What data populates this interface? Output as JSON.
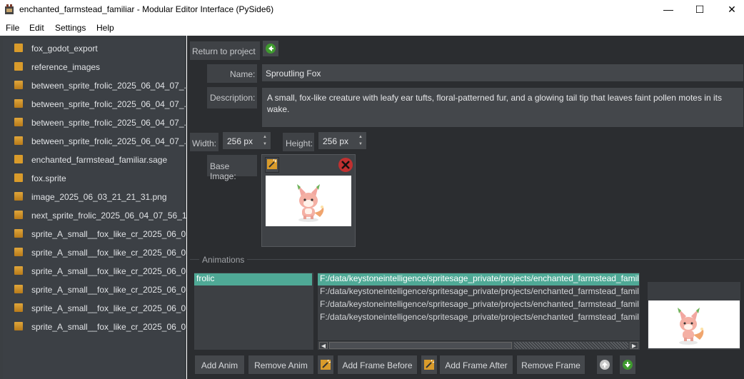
{
  "window": {
    "title": "enchanted_farmstead_familiar - Modular Editor Interface (PySide6)",
    "minimize": "—",
    "maximize": "☐",
    "close": "✕"
  },
  "menu": [
    "File",
    "Edit",
    "Settings",
    "Help"
  ],
  "files": [
    {
      "label": "fox_godot_export",
      "icon": "folder-icon"
    },
    {
      "label": "reference_images",
      "icon": "folder-icon"
    },
    {
      "label": "between_sprite_frolic_2025_06_04_07_...",
      "icon": "image-icon"
    },
    {
      "label": "between_sprite_frolic_2025_06_04_07_...",
      "icon": "image-icon"
    },
    {
      "label": "between_sprite_frolic_2025_06_04_07_...",
      "icon": "image-icon"
    },
    {
      "label": "between_sprite_frolic_2025_06_04_07_...",
      "icon": "image-icon"
    },
    {
      "label": "enchanted_farmstead_familiar.sage",
      "icon": "project-file-icon"
    },
    {
      "label": "fox.sprite",
      "icon": "sprite-file-icon"
    },
    {
      "label": "image_2025_06_03_21_21_31.png",
      "icon": "image-icon"
    },
    {
      "label": "next_sprite_frolic_2025_06_04_07_56_1...",
      "icon": "image-icon"
    },
    {
      "label": "sprite_A_small__fox_like_cr_2025_06_0...",
      "icon": "image-icon"
    },
    {
      "label": "sprite_A_small__fox_like_cr_2025_06_0...",
      "icon": "image-icon"
    },
    {
      "label": "sprite_A_small__fox_like_cr_2025_06_0...",
      "icon": "image-icon"
    },
    {
      "label": "sprite_A_small__fox_like_cr_2025_06_0...",
      "icon": "image-icon"
    },
    {
      "label": "sprite_A_small__fox_like_cr_2025_06_0...",
      "icon": "image-icon"
    },
    {
      "label": "sprite_A_small__fox_like_cr_2025_06_0...",
      "icon": "image-icon"
    }
  ],
  "editor": {
    "return_label": "Return to project",
    "name_label": "Name:",
    "name_value": "Sproutling Fox",
    "description_label": "Description:",
    "description_value": "A small, fox-like creature with leafy ear tufts, floral-patterned fur, and a glowing tail tip that leaves faint pollen motes in its wake.",
    "width_label": "Width:",
    "width_value": "256 px",
    "height_label": "Height:",
    "height_value": "256 px",
    "base_image_label": "Base Image:"
  },
  "animations": {
    "group_title": "Animations",
    "anims": [
      "frolic"
    ],
    "frames": [
      "F:/data/keystoneintelligence/spritesage_private/projects/enchanted_farmstead_famil",
      "F:/data/keystoneintelligence/spritesage_private/projects/enchanted_farmstead_famil",
      "F:/data/keystoneintelligence/spritesage_private/projects/enchanted_farmstead_famil",
      "F:/data/keystoneintelligence/spritesage_private/projects/enchanted_farmstead_famil"
    ],
    "buttons": {
      "add_anim": "Add Anim",
      "remove_anim": "Remove Anim",
      "add_frame_before": "Add Frame Before",
      "add_frame_after": "Add Frame After",
      "remove_frame": "Remove Frame"
    }
  },
  "colors": {
    "panel_bg": "#2b2d30",
    "sidebar_bg": "#3c4045",
    "selection": "#4fa996",
    "accent_green": "#3f9a2f",
    "icon_orange": "#d99b2b",
    "delete_red": "#c03030"
  }
}
